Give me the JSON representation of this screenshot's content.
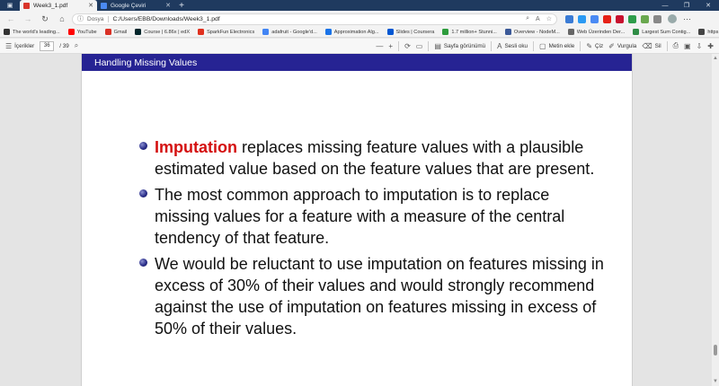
{
  "tabs": [
    {
      "title": "Week3_1.pdf",
      "color": "#d9352b",
      "active": true
    },
    {
      "title": "Google Çeviri",
      "color": "#4a8af4",
      "active": false
    }
  ],
  "address": {
    "scheme": "Dosya",
    "url": "C:/Users/EBB/Downloads/Week3_1.pdf"
  },
  "bookmarks": [
    {
      "label": "The world's leading...",
      "color": "#333333"
    },
    {
      "label": "YouTube",
      "color": "#ff0000"
    },
    {
      "label": "Gmail",
      "color": "#d93025"
    },
    {
      "label": "Course | 6.86x | edX",
      "color": "#02262b"
    },
    {
      "label": "SparkFun Electronics",
      "color": "#e0301e"
    },
    {
      "label": "adafruit - Google'd...",
      "color": "#4285f4"
    },
    {
      "label": "Approximation Alg...",
      "color": "#1a73e8"
    },
    {
      "label": "Slides | Coursera",
      "color": "#0056d2"
    },
    {
      "label": "1.7 million+ Stunni...",
      "color": "#2d9c3c"
    },
    {
      "label": "Overview - NodeM...",
      "color": "#3b5998"
    },
    {
      "label": "Web Üzerinden Der...",
      "color": "#666666"
    },
    {
      "label": "Largest Sum Contig...",
      "color": "#2f8d46"
    },
    {
      "label": "https://wiki.osdev.o...",
      "color": "#444444"
    }
  ],
  "pdf_toolbar": {
    "contents_label": "İçerikler",
    "current_page": "36",
    "total_pages": "/ 39",
    "minus": "—",
    "plus": "+",
    "page_view": "Sayfa görünümü",
    "read_aloud": "Sesli oku",
    "add_text": "Metin ekle",
    "draw": "Çiz",
    "highlight": "Vurgula",
    "erase": "Sil"
  },
  "slide": {
    "title": "Handling Missing Values",
    "bullets": [
      {
        "keyword": "Imputation",
        "text": " replaces missing feature values with a plausible estimated value based on the feature values that are present."
      },
      {
        "keyword": "",
        "text": "The most common approach to imputation is to replace missing values for a feature with a measure of the central tendency of that feature."
      },
      {
        "keyword": "",
        "text": "We would be reluctant to use imputation on features missing in excess of 30% of their values and would strongly recommend against the use of imputation on features missing in excess of 50% of their values."
      }
    ]
  },
  "colors": {
    "slide_header": "#262393",
    "keyword": "#d41010",
    "tabstrip": "#1f3a5f"
  }
}
